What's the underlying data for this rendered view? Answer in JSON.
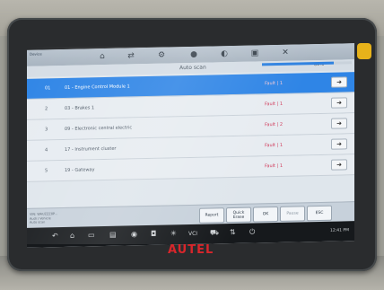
{
  "device": {
    "label": "Device",
    "brand": "AUTEL",
    "sticker_color": "#e7b21a"
  },
  "toolbar": {
    "icons": [
      "home-icon",
      "swap-icon",
      "gear-icon",
      "globe-icon",
      "info-icon",
      "print-icon",
      "close-icon"
    ]
  },
  "scan": {
    "title": "Auto scan",
    "progress_text": "80%",
    "progress_fraction": 0.8
  },
  "rows": [
    {
      "num": "01",
      "name": "01 - Engine Control Module 1",
      "status": "Fault | 1",
      "selected": true
    },
    {
      "num": "2",
      "name": "03 - Brakes 1",
      "status": "Fault | 1",
      "selected": false
    },
    {
      "num": "3",
      "name": "09 - Electronic central electric",
      "status": "Fault | 2",
      "selected": false
    },
    {
      "num": "4",
      "name": "17 - Instrument cluster",
      "status": "Fault | 1",
      "selected": false
    },
    {
      "num": "5",
      "name": "19 - Gateway",
      "status": "Fault | 1",
      "selected": false
    }
  ],
  "vehicle_info": {
    "line1": "VIN: WAUZZZ8P...",
    "line2": "Audi / Vehicle",
    "line3": "Auto scan"
  },
  "buttons": {
    "report": "Report",
    "quick_erase": "Quick Erase",
    "ok": "OK",
    "pause": "Pause",
    "esc": "ESC"
  },
  "navbar": {
    "vci_label": "VCI",
    "clock": "12:41 PM"
  },
  "colors": {
    "accent": "#2f85e6",
    "fault": "#d03a5a",
    "brand": "#d8262b"
  }
}
